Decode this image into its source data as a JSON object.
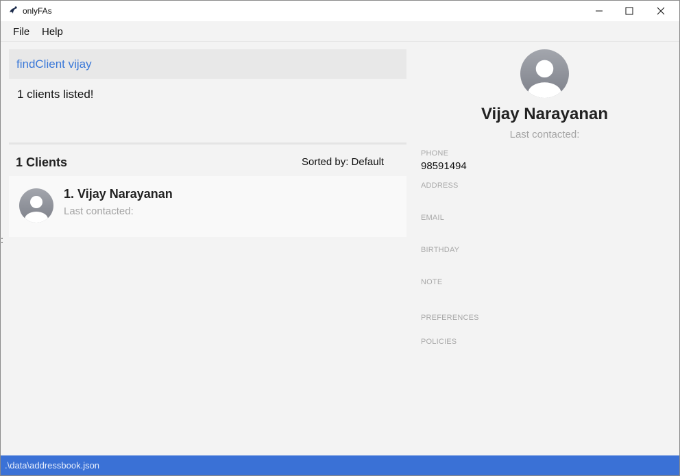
{
  "window": {
    "title": "onlyFAs",
    "controls": {
      "minimize_icon": "minimize-icon",
      "maximize_icon": "maximize-icon",
      "close_icon": "close-icon"
    }
  },
  "menu": {
    "file": "File",
    "help": "Help"
  },
  "command": {
    "text": "findClient vijay"
  },
  "result": {
    "message": "1 clients listed!"
  },
  "client_list": {
    "count_label": "1 Clients",
    "sorted_by": "Sorted by: Default",
    "clients": [
      {
        "name": "1.  Vijay Narayanan",
        "last_contacted": "Last contacted:"
      }
    ]
  },
  "detail": {
    "name": "Vijay Narayanan",
    "last_contacted": "Last contacted:",
    "fields": {
      "phone_label": "PHONE",
      "phone_value": "98591494",
      "address_label": "ADDRESS",
      "email_label": "EMAIL",
      "birthday_label": "BIRTHDAY",
      "note_label": "NOTE",
      "preferences_label": "PREFERENCES",
      "policies_label": "POLICIES"
    }
  },
  "status": {
    "path": ".\\data\\addressbook.json"
  },
  "colors": {
    "accent": "#3a71d6",
    "command_text": "#3a78d8",
    "muted": "#a4a4a4"
  }
}
